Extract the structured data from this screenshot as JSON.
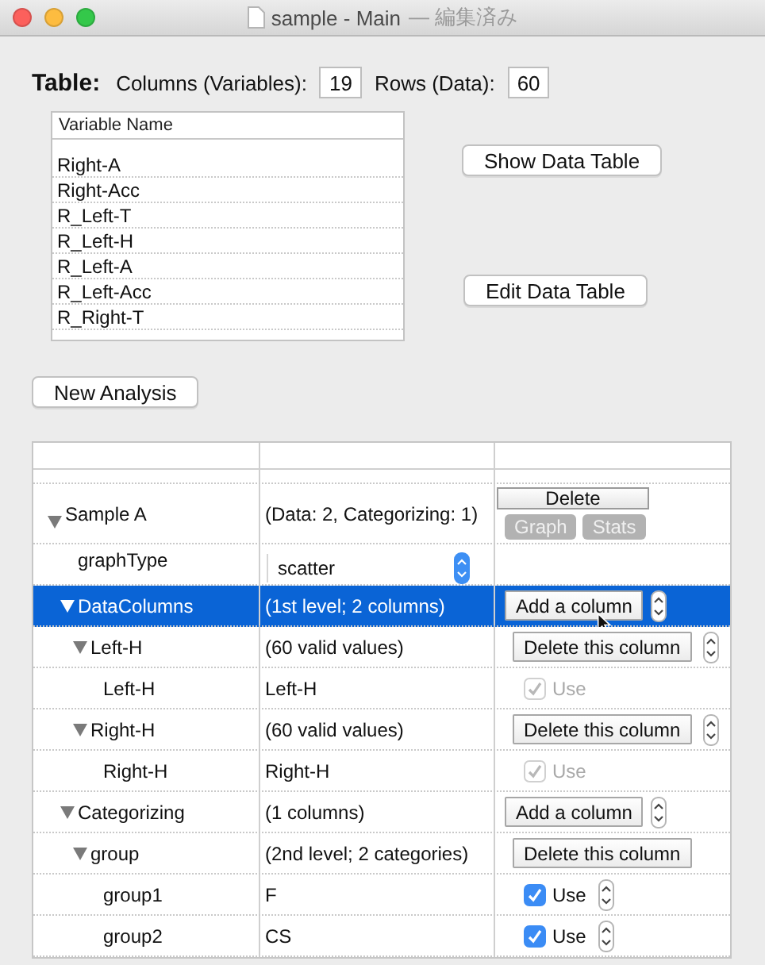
{
  "window": {
    "title": "sample - Main",
    "status": "— 編集済み"
  },
  "table": {
    "label": "Table:",
    "columns_label": "Columns (Variables):",
    "columns_value": "19",
    "rows_label": "Rows (Data):",
    "rows_value": "60"
  },
  "variable_list": {
    "header": "Variable Name",
    "items": [
      "Right-A",
      "Right-Acc",
      "R_Left-T",
      "R_Left-H",
      "R_Left-A",
      "R_Left-Acc",
      "R_Right-T"
    ]
  },
  "buttons": {
    "show": "Show Data Table",
    "edit": "Edit Data Table",
    "new_analysis": "New Analysis"
  },
  "outline": {
    "rows": [
      {
        "label": "Sample A",
        "expanded": true,
        "selected": false,
        "info": "(Data: 2, Categorizing: 1)",
        "control": {
          "kind": "sample",
          "delete": "Delete",
          "buttons": [
            {
              "label": "Graph",
              "disabled": true
            },
            {
              "label": "Stats",
              "disabled": true
            }
          ]
        },
        "children": [
          {
            "label": "graphType",
            "selected": false,
            "control": {
              "kind": "popup",
              "value": "scatter"
            }
          },
          {
            "label": "DataColumns",
            "expanded": true,
            "selected": true,
            "info": "(1st level; 2 columns)",
            "control": {
              "kind": "add",
              "label": "Add a column",
              "stepper": true
            },
            "children": [
              {
                "label": "Left-H",
                "expanded": true,
                "selected": false,
                "info": "(60 valid values)",
                "control": {
                  "kind": "delete",
                  "label": "Delete this column",
                  "stepper": true
                },
                "children": [
                  {
                    "label": "Left-H",
                    "selected": false,
                    "info": "Left-H",
                    "control": {
                      "kind": "check",
                      "label": "Use",
                      "checked": true,
                      "disabled": true,
                      "stepper": false
                    }
                  }
                ]
              },
              {
                "label": "Right-H",
                "expanded": true,
                "selected": false,
                "info": "(60 valid values)",
                "control": {
                  "kind": "delete",
                  "label": "Delete this column",
                  "stepper": true
                },
                "children": [
                  {
                    "label": "Right-H",
                    "selected": false,
                    "info": "Right-H",
                    "control": {
                      "kind": "check",
                      "label": "Use",
                      "checked": true,
                      "disabled": true,
                      "stepper": false
                    }
                  }
                ]
              }
            ]
          },
          {
            "label": "Categorizing",
            "expanded": true,
            "selected": false,
            "info": "(1 columns)",
            "control": {
              "kind": "add",
              "label": "Add a column",
              "stepper": true
            },
            "children": [
              {
                "label": "group",
                "expanded": true,
                "selected": false,
                "info": "(2nd level; 2 categories)",
                "control": {
                  "kind": "delete",
                  "label": "Delete this column",
                  "stepper": false
                },
                "children": [
                  {
                    "label": "group1",
                    "selected": false,
                    "info": "F",
                    "control": {
                      "kind": "check",
                      "label": "Use",
                      "checked": true,
                      "disabled": false,
                      "stepper": true
                    }
                  },
                  {
                    "label": "group2",
                    "selected": false,
                    "info": "CS",
                    "control": {
                      "kind": "check",
                      "label": "Use",
                      "checked": true,
                      "disabled": false,
                      "stepper": true
                    }
                  }
                ]
              }
            ]
          }
        ]
      }
    ]
  }
}
